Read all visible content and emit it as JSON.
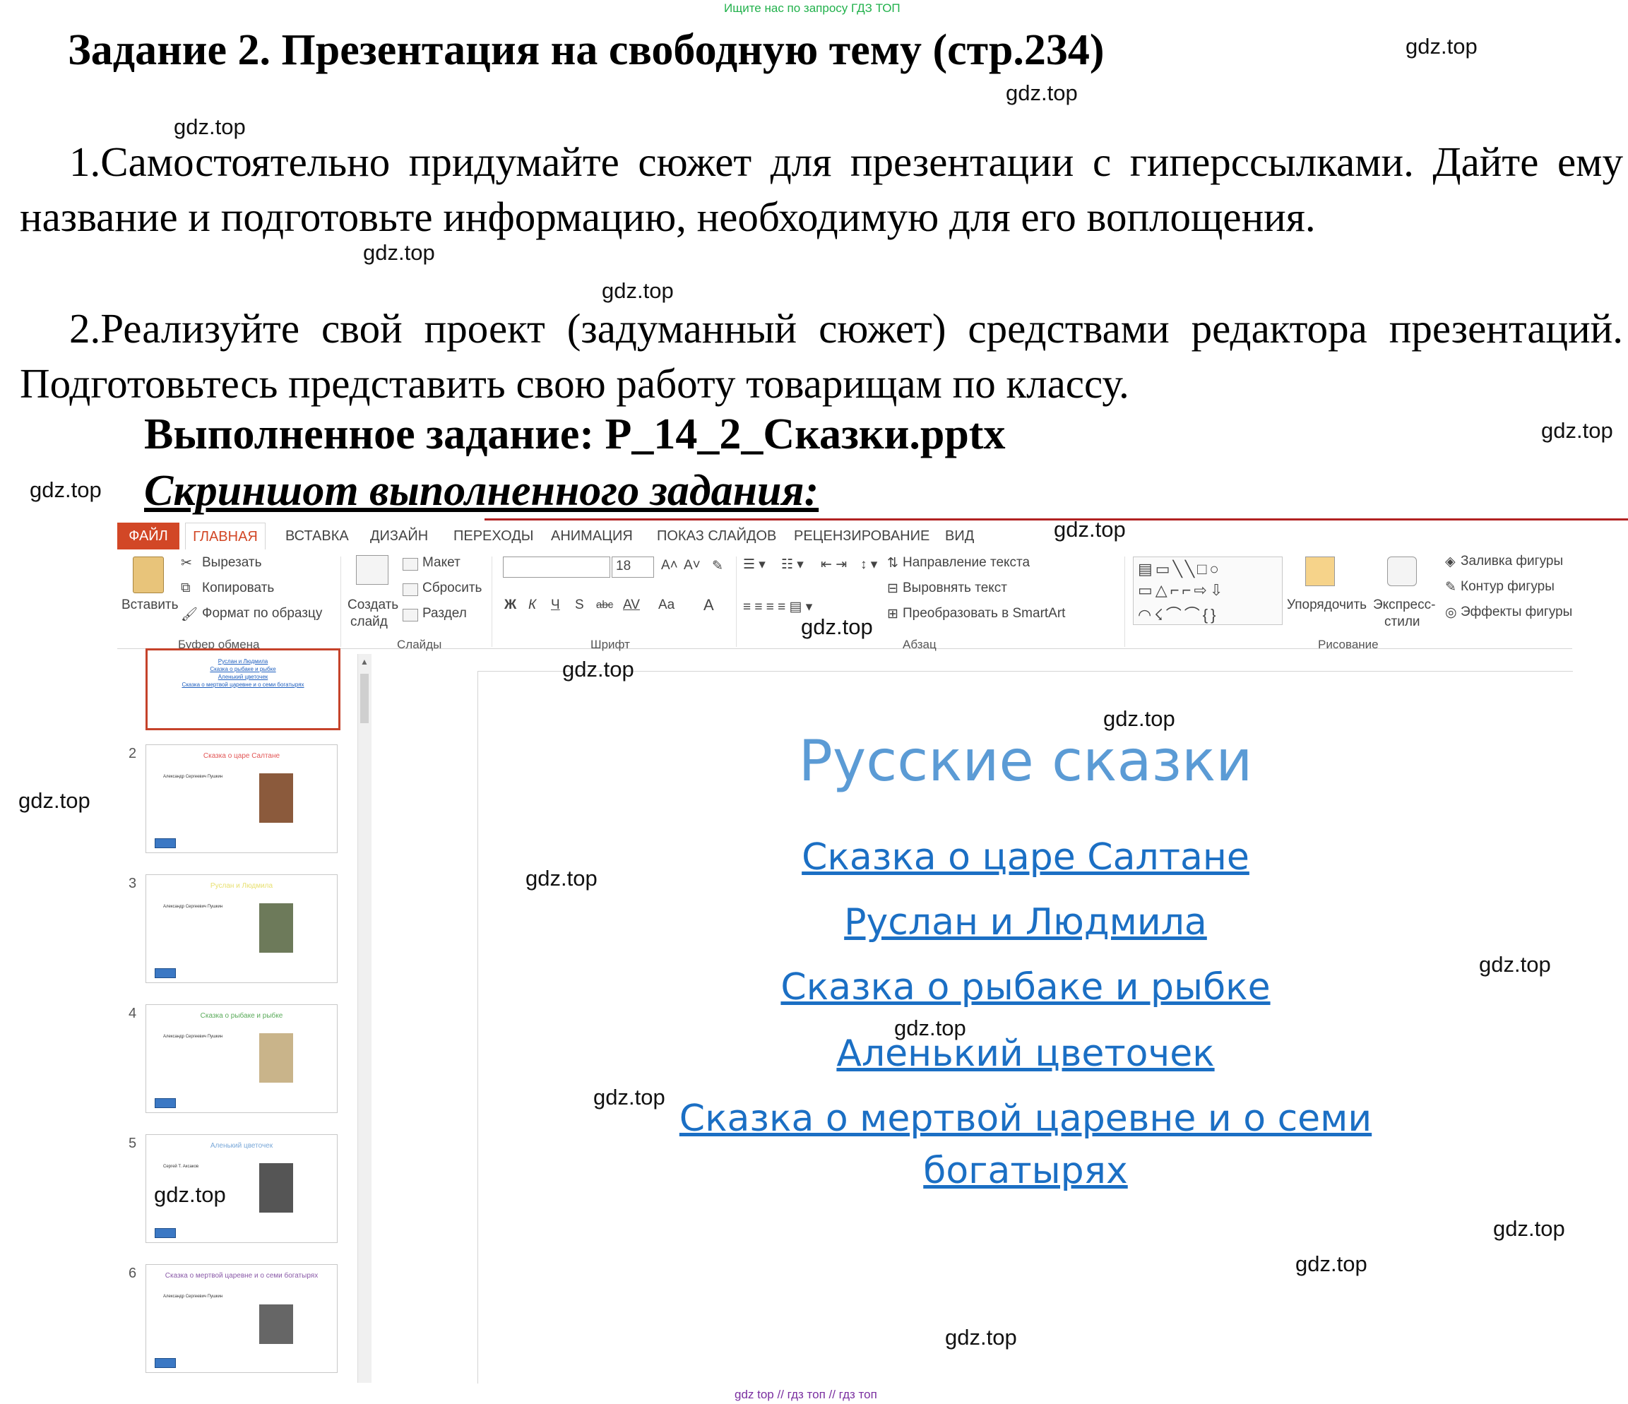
{
  "top_note": "Ищите нас по запросу ГДЗ ТОП",
  "title": "Задание 2. Презентация на свободную тему (стр.234)",
  "paragraph1": "1.Самостоятельно придумайте сюжет для презентации с гиперссылками. Дайте ему название и подготовьте информацию, необходимую для его воплощения.",
  "paragraph2": "2.Реализуйте свой проект (задуманный сюжет) средствами редактора презентаций. Подготовьтесь представить свою работу товарищам по классу.",
  "done_label": "Выполненное задание: Р_14_2_Сказки.pptx",
  "screenshot_label": "Скриншот выполненного задания:",
  "watermark": "gdz.top",
  "bottom_note": "gdz top // гдз топ // гдз топ",
  "app": {
    "tabs": [
      "ФАЙЛ",
      "ГЛАВНАЯ",
      "ВСТАВКА",
      "ДИЗАЙН",
      "ПЕРЕХОДЫ",
      "АНИМАЦИЯ",
      "ПОКАЗ СЛАЙДОВ",
      "РЕЦЕНЗИРОВАНИЕ",
      "ВИД"
    ],
    "clipboard": {
      "paste": "Вставить",
      "cut": "Вырезать",
      "copy": "Копировать",
      "format": "Формат по образцу",
      "group": "Буфер обмена"
    },
    "slides": {
      "new_slide_1": "Создать",
      "new_slide_2": "слайд",
      "layout": "Макет",
      "reset": "Сбросить",
      "section": "Раздел",
      "group": "Слайды"
    },
    "font": {
      "size": "18",
      "bold": "Ж",
      "italic": "К",
      "underline": "Ч",
      "shadow": "S",
      "strike": "abc",
      "spacing": "AV",
      "case": "Aa",
      "color": "A",
      "group": "Шрифт"
    },
    "paragraph": {
      "direction": "Направление текста",
      "align": "Выровнять текст",
      "smartart": "Преобразовать в SmartArt",
      "group": "Абзац"
    },
    "drawing": {
      "arrange": "Упорядочить",
      "quick_styles_1": "Экспресс-",
      "quick_styles_2": "стили",
      "fill": "Заливка фигуры",
      "outline": "Контур фигуры",
      "effects": "Эффекты фигуры",
      "group": "Рисование"
    }
  },
  "thumbnails": [
    {
      "num": "",
      "links": [
        "Руслан и Людмила",
        "Сказка о рыбаке и рыбке",
        "Аленький цветочек",
        "Сказка о мертвой царевне и о семи богатырях"
      ]
    },
    {
      "num": "2",
      "title": "Сказка о царе Салтане",
      "author": "Александр Сергеевич Пушкин",
      "title_color": "#e25555",
      "img_color": "#8b5a3c"
    },
    {
      "num": "3",
      "title": "Руслан и Людмила",
      "author": "Александр Сергеевич Пушкин",
      "title_color": "#e8e070",
      "img_color": "#6d7a5a"
    },
    {
      "num": "4",
      "title": "Сказка о рыбаке и рыбке",
      "author": "Александр Сергеевич Пушкин",
      "title_color": "#5aab5a",
      "img_color": "#c9b48a"
    },
    {
      "num": "5",
      "title": "Аленький цветочек",
      "author": "Сергей Т. Аксаков",
      "title_color": "#7aa8d8",
      "img_color": "#555555"
    },
    {
      "num": "6",
      "title": "Сказка о мертвой царевне и о семи богатырях",
      "author": "Александр Сергеевич Пушкин",
      "title_color": "#8a5aa8",
      "img_color": "#666666"
    }
  ],
  "slide": {
    "title": "Русские сказки",
    "links": [
      "Сказка о царе Салтане",
      "Руслан и Людмила",
      "Сказка о рыбаке и рыбке",
      "Аленький цветочек",
      "Сказка о мертвой царевне и о семи",
      "богатырях"
    ]
  },
  "colors": {
    "accent": "#d24726",
    "link": "#1b6fc4",
    "slide_title": "#5b9bd5"
  }
}
